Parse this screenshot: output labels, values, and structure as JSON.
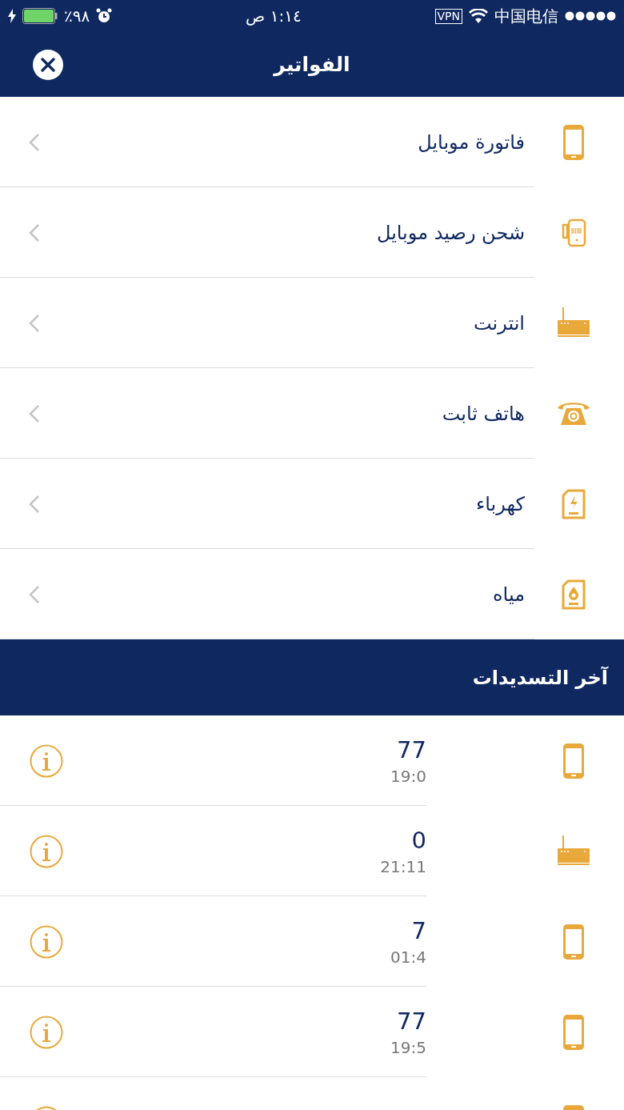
{
  "status_bar": {
    "battery": "٪٩٨",
    "time": "١:١٤ ص",
    "vpn": "VPN",
    "carrier": "中国电信"
  },
  "header": {
    "title": "الفواتير"
  },
  "bills": [
    {
      "label": "فاتورة موبايل",
      "kind": "mobile"
    },
    {
      "label": "شحن رصيد موبايل",
      "kind": "recharge"
    },
    {
      "label": "انترنت",
      "kind": "internet"
    },
    {
      "label": "هاتف ثابت",
      "kind": "landline"
    },
    {
      "label": "كهرباء",
      "kind": "electricity"
    },
    {
      "label": "مياه",
      "kind": "water"
    }
  ],
  "recent": {
    "title": "آخر التسديدات",
    "items": [
      {
        "amount": "77",
        "time": "19:0",
        "kind": "mobile"
      },
      {
        "amount": "0",
        "time": "21:11",
        "kind": "internet"
      },
      {
        "amount": "7",
        "time": "01:4",
        "kind": "mobile"
      },
      {
        "amount": "77",
        "time": "19:5",
        "kind": "mobile"
      },
      {
        "kind": "mobile"
      }
    ]
  }
}
